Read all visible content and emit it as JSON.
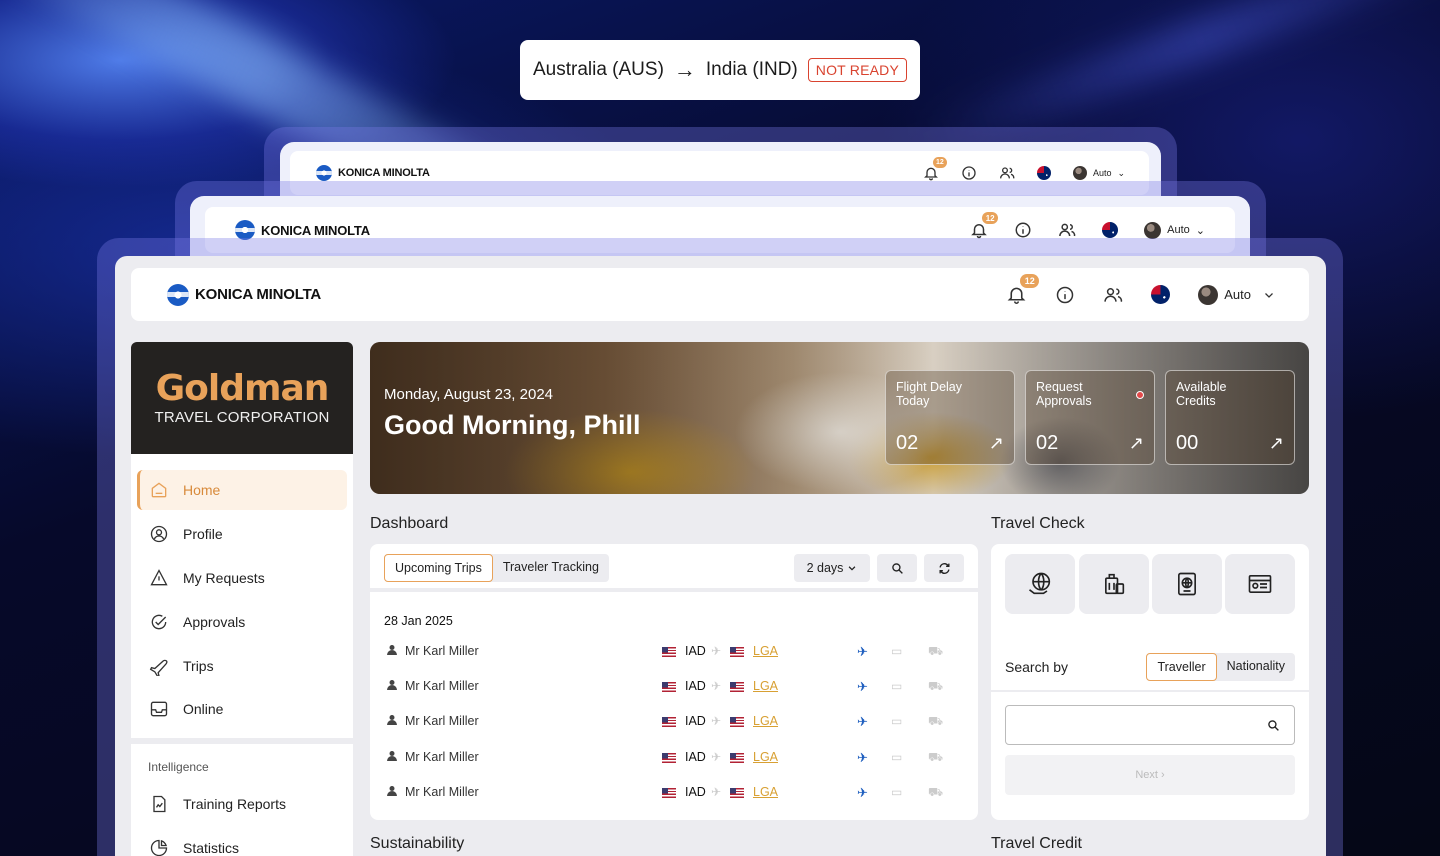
{
  "route": {
    "origin": "Australia (AUS)",
    "arrow": "→",
    "destination": "India (IND)",
    "status": "NOT READY"
  },
  "header": {
    "brand": "KONICA MINOLTA",
    "notifications_count": "12",
    "profile_label": "Auto",
    "icons": [
      "bell-icon",
      "info-icon",
      "users-icon",
      "australia-flag-icon",
      "avatar",
      "chevron-down-icon"
    ]
  },
  "sidebar": {
    "company_name": "Goldman",
    "company_sub": "TRAVEL CORPORATION",
    "items": [
      {
        "label": "Home",
        "icon": "home-icon",
        "active": true
      },
      {
        "label": "Profile",
        "icon": "profile-icon",
        "active": false
      },
      {
        "label": "My Requests",
        "icon": "requests-icon",
        "active": false
      },
      {
        "label": "Approvals",
        "icon": "approvals-icon",
        "active": false
      },
      {
        "label": "Trips",
        "icon": "plane-icon",
        "active": false
      },
      {
        "label": "Online",
        "icon": "inbox-icon",
        "active": false
      }
    ],
    "section_label": "Intelligence",
    "items2": [
      {
        "label": "Training Reports",
        "icon": "report-icon"
      },
      {
        "label": "Statistics",
        "icon": "pie-chart-icon"
      }
    ]
  },
  "hero": {
    "date": "Monday, August 23, 2024",
    "greeting": "Good Morning, Phill",
    "stats": [
      {
        "label": "Flight Delay Today",
        "value": "02"
      },
      {
        "label": "Request Approvals",
        "value": "02"
      },
      {
        "label": "Available Credits",
        "value": "00"
      }
    ]
  },
  "dashboard": {
    "title": "Dashboard",
    "tabs": [
      "Upcoming Trips",
      "Traveler Tracking"
    ],
    "range": "2 days",
    "date_group": "28 Jan 2025",
    "trips": [
      {
        "traveler": "Mr Karl Miller",
        "from": "IAD",
        "to": "LGA"
      },
      {
        "traveler": "Mr Karl Miller",
        "from": "IAD",
        "to": "LGA"
      },
      {
        "traveler": "Mr Karl Miller",
        "from": "IAD",
        "to": "LGA"
      },
      {
        "traveler": "Mr Karl Miller",
        "from": "IAD",
        "to": "LGA"
      },
      {
        "traveler": "Mr Karl Miller",
        "from": "IAD",
        "to": "LGA"
      }
    ]
  },
  "travel_check": {
    "title": "Travel Check",
    "search_by": "Search by",
    "options": [
      "Traveller",
      "Nationality"
    ],
    "next": "Next ›"
  },
  "footer_sections": {
    "sustainability": "Sustainability",
    "travel_credit": "Travel Credit"
  },
  "colors": {
    "accent": "#e8a25a",
    "status_red": "#d9432f",
    "brand_blue": "#1a5bc4"
  }
}
